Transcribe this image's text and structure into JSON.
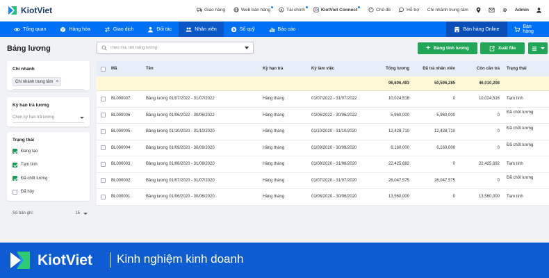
{
  "app": {
    "brand": "KiotViet"
  },
  "topbar": {
    "links": [
      {
        "label": "Giao hàng",
        "icon": "truck-icon",
        "dot": false
      },
      {
        "label": "Web bán hàng",
        "icon": "globe-icon",
        "dot": true
      },
      {
        "label": "Tài chính",
        "icon": "dollar-icon",
        "dot": true
      },
      {
        "label": "KiotViet Connect",
        "icon": "connect-icon",
        "dot": true
      },
      {
        "label": "Chủ đề",
        "icon": "palette-icon",
        "dot": false
      },
      {
        "label": "Hỗ trợ",
        "icon": "chat-icon",
        "dot": false
      }
    ],
    "branch": "Chi nhánh trung tâm",
    "user": "Admin"
  },
  "nav": {
    "items": [
      {
        "label": "Tổng quan",
        "icon": "eye-icon",
        "active": false
      },
      {
        "label": "Hàng hóa",
        "icon": "box-icon",
        "active": false
      },
      {
        "label": "Giao dịch",
        "icon": "exchange-icon",
        "active": false
      },
      {
        "label": "Đối tác",
        "icon": "partner-icon",
        "active": false
      },
      {
        "label": "Nhân viên",
        "icon": "staff-icon",
        "active": true
      },
      {
        "label": "Sổ quỹ",
        "icon": "cash-icon",
        "active": false
      },
      {
        "label": "Báo cáo",
        "icon": "chart-icon",
        "active": false
      }
    ],
    "online_label": "Bán hàng Online",
    "sell_label": "Bán hàng"
  },
  "page": {
    "title": "Bảng lương"
  },
  "search": {
    "placeholder": "Theo mã, tên bảng lương"
  },
  "actions": {
    "create": "Bảng tính lương",
    "export": "Xuất file"
  },
  "filters": {
    "branch": {
      "title": "Chi nhánh",
      "chip": "Chi nhánh trung tâm"
    },
    "period": {
      "title": "Kỳ hạn trả lương",
      "placeholder": "Chọn kỳ hạn trả lương"
    },
    "status": {
      "title": "Trạng thái",
      "options": [
        {
          "label": "Đang tạo",
          "checked": true
        },
        {
          "label": "Tạm tính",
          "checked": true
        },
        {
          "label": "Đã chốt lương",
          "checked": true
        },
        {
          "label": "Đã hủy",
          "checked": false
        }
      ]
    }
  },
  "records": {
    "label": "Số bản ghi:",
    "value": "15"
  },
  "table": {
    "headers": [
      "Mã",
      "Tên",
      "Kỳ hạn trả",
      "Kỳ làm việc",
      "Tổng lương",
      "Đã trả nhân viên",
      "Còn cần trả",
      "Trạng thái"
    ],
    "totals": {
      "total": "96,606,493",
      "paid": "50,596,285",
      "remaining": "46,010,208"
    },
    "rows": [
      {
        "code": "BL000007",
        "name": "Bảng lương 01/07/2022 - 31/07/2022",
        "term": "Hàng tháng",
        "period": "01/07/2022 - 31/07/2022",
        "total": "10,024,516",
        "paid": "0",
        "remaining": "10,024,516",
        "status": "Tạm tính"
      },
      {
        "code": "BL000006",
        "name": "Bảng lương 01/06/2022 - 30/06/2022",
        "term": "Hàng tháng",
        "period": "01/06/2022 - 30/06/2022",
        "total": "5,960,000",
        "paid": "5,960,000",
        "remaining": "0",
        "status": "Đã chốt lương"
      },
      {
        "code": "BL000005",
        "name": "Bảng lương 01/10/2020 - 31/10/2020",
        "term": "Hàng tháng",
        "period": "01/10/2020 - 31/10/2020",
        "total": "12,428,710",
        "paid": "12,428,710",
        "remaining": "0",
        "status": "Đã chốt lương"
      },
      {
        "code": "BL000004",
        "name": "Bảng lương 01/09/2020 - 30/09/2020",
        "term": "Hàng tháng",
        "period": "01/09/2020 - 30/09/2020",
        "total": "6,160,000",
        "paid": "6,160,000",
        "remaining": "0",
        "status": "Đã chốt lương"
      },
      {
        "code": "BL000003",
        "name": "Bảng lương 01/08/2020 - 31/08/2020",
        "term": "Hàng tháng",
        "period": "01/08/2020 - 31/08/2020",
        "total": "22,425,692",
        "paid": "0",
        "remaining": "22,425,692",
        "status": "Tạm tính"
      },
      {
        "code": "BL000002",
        "name": "Bảng lương 01/07/2020 - 31/07/2020",
        "term": "Hàng tháng",
        "period": "01/07/2020 - 31/07/2020",
        "total": "26,047,575",
        "paid": "26,047,575",
        "remaining": "0",
        "status": "Đã chốt lương"
      },
      {
        "code": "BL000001",
        "name": "Bảng lương 01/06/2020 - 30/06/2020",
        "term": "Hàng tháng",
        "period": "01/06/2020 - 30/06/2020",
        "total": "13,560,000",
        "paid": "0",
        "remaining": "13,560,000",
        "status": "Tạm tính"
      }
    ]
  },
  "banner": {
    "brand": "KiotViet",
    "tagline": "Kinh nghiệm kinh doanh"
  },
  "colors": {
    "primary": "#0070f4",
    "green": "#21a557",
    "banner": "#0f5bd1"
  }
}
